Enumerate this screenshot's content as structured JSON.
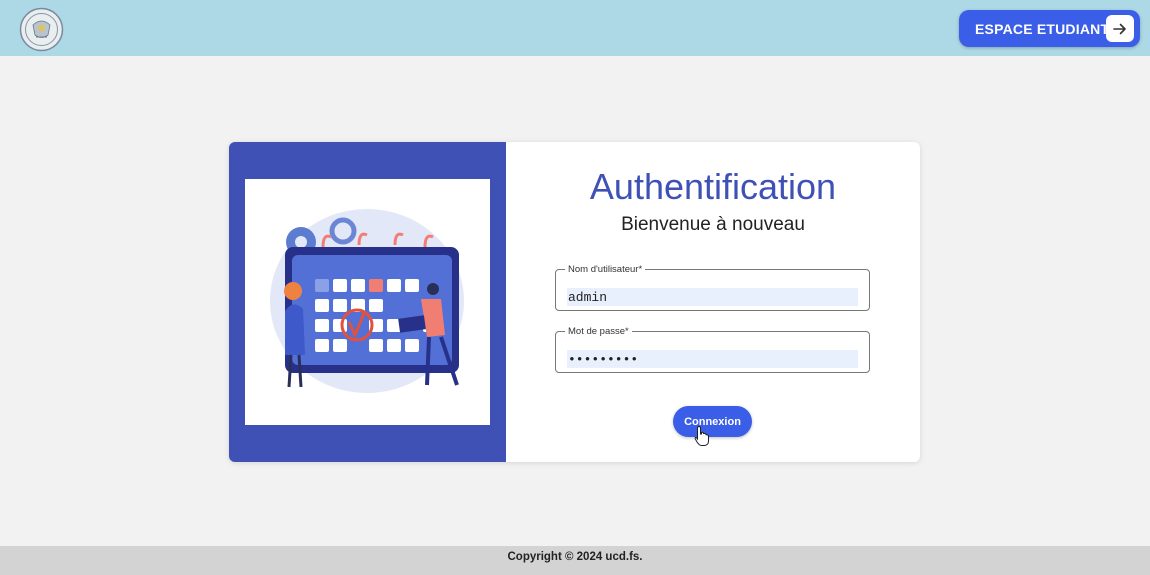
{
  "header": {
    "logo_icon": "university-seal-icon",
    "student_button_label": "ESPACE ETUDIANT",
    "student_button_icon": "arrow-right-icon",
    "background": "#add8e6"
  },
  "login": {
    "title": "Authentification",
    "subtitle": "Bienvenue à nouveau",
    "username_label": "Nom d'utilisateur*",
    "username_value": "admin",
    "password_label": "Mot de passe*",
    "password_value": "admin1234",
    "submit_label": "Connexion",
    "illustration_icon": "calendar-planning-illustration",
    "accent_color": "#3f51b5",
    "button_color": "#3b5ee8"
  },
  "footer": {
    "copyright": "Copyright © 2024 ucd.fs."
  }
}
